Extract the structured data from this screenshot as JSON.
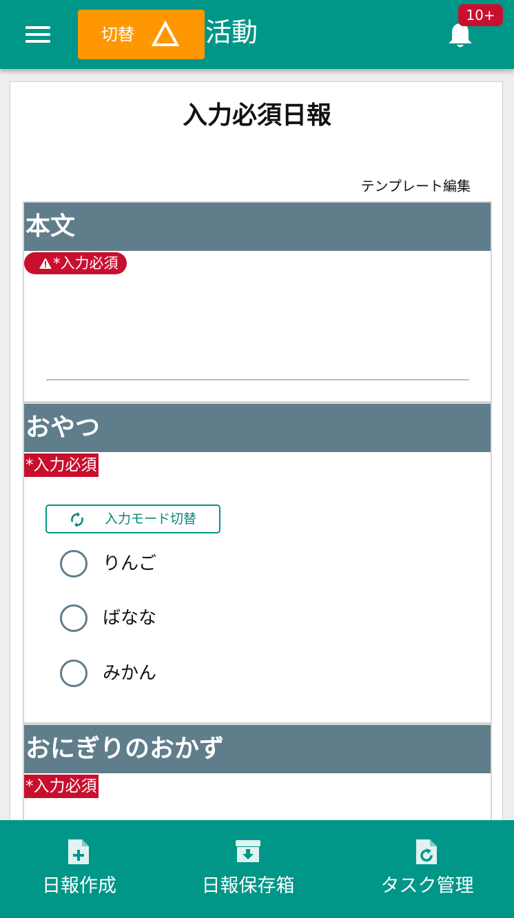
{
  "header": {
    "switch_label": "切替",
    "title": "活動",
    "notification_count": "10+"
  },
  "page": {
    "title": "入力必須日報",
    "template_edit": "テンプレート編集"
  },
  "sections": [
    {
      "heading": "本文",
      "required": "*入力必須",
      "required_style": "pill-with-warning-icon"
    },
    {
      "heading": "おやつ",
      "required": "*入力必須",
      "mode_switch_label": "入力モード切替",
      "options": [
        "りんご",
        "ばなな",
        "みかん"
      ]
    },
    {
      "heading": "おにぎりのおかず",
      "required": "*入力必須"
    }
  ],
  "bottom_nav": {
    "items": [
      {
        "label": "日報作成",
        "icon": "file-plus-icon"
      },
      {
        "label": "日報保存箱",
        "icon": "archive-download-icon"
      },
      {
        "label": "タスク管理",
        "icon": "file-refresh-icon"
      }
    ]
  },
  "colors": {
    "primary": "#009688",
    "accent_orange": "#ff9800",
    "section_header": "#607d8b",
    "required_red": "#c8102e"
  }
}
